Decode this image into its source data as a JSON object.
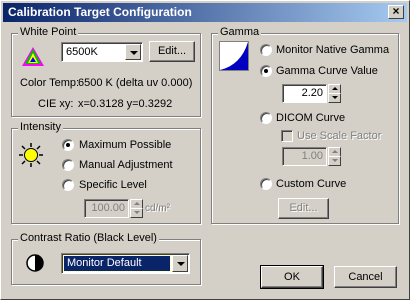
{
  "window": {
    "title": "Calibration Target Configuration",
    "close_glyph": "×"
  },
  "white_point": {
    "legend": "White Point",
    "selected": "6500K",
    "edit_label": "Edit...",
    "color_temp_label": "Color Temp:",
    "color_temp_value": "6500 K (delta uv 0.000)",
    "cie_label": "CIE xy:",
    "cie_value": "x=0.3128 y=0.3292"
  },
  "intensity": {
    "legend": "Intensity",
    "options": [
      "Maximum Possible",
      "Manual Adjustment",
      "Specific Level"
    ],
    "selected_index": 0,
    "level_value": "100.00",
    "unit": "cd/m²"
  },
  "contrast": {
    "legend": "Contrast Ratio (Black Level)",
    "selected": "Monitor Default"
  },
  "gamma": {
    "legend": "Gamma",
    "options": [
      "Monitor Native Gamma",
      "Gamma Curve Value",
      "DICOM Curve",
      "Custom Curve"
    ],
    "selected_index": 1,
    "curve_value": "2.20",
    "use_scale_label": "Use Scale Factor",
    "scale_value": "1.00",
    "edit_label": "Edit..."
  },
  "buttons": {
    "ok": "OK",
    "cancel": "Cancel"
  },
  "colors": {
    "titlebar_start": "#0a246a",
    "titlebar_end": "#a6caf0",
    "selection": "#0a246a",
    "face": "#d4d0c8"
  }
}
